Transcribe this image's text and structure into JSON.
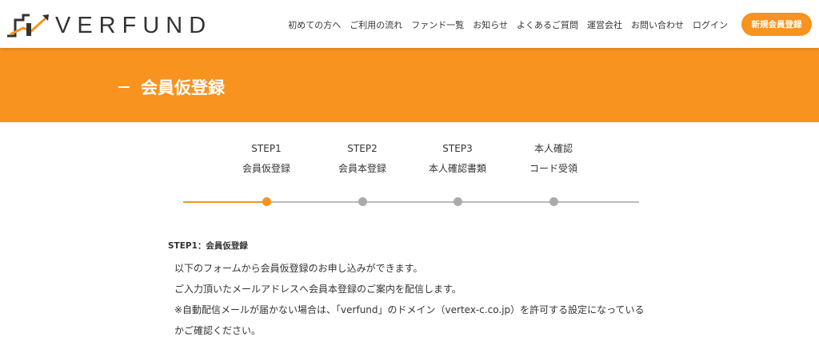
{
  "header": {
    "logo_text": "VERFUND",
    "nav": [
      {
        "label": "初めての方へ"
      },
      {
        "label": "ご利用の流れ"
      },
      {
        "label": "ファンド一覧"
      },
      {
        "label": "お知らせ"
      },
      {
        "label": "よくあるご質問"
      },
      {
        "label": "運営会社"
      },
      {
        "label": "お問い合わせ"
      },
      {
        "label": "ログイン"
      }
    ],
    "register_label": "新規会員登録"
  },
  "banner": {
    "title": "会員仮登録"
  },
  "steps": [
    {
      "line1": "STEP1",
      "line2": "会員仮登録",
      "active": true
    },
    {
      "line1": "STEP2",
      "line2": "会員本登録",
      "active": false
    },
    {
      "line1": "STEP3",
      "line2": "本人確認書類",
      "active": false
    },
    {
      "line1": "本人確認",
      "line2": "コード受領",
      "active": false
    }
  ],
  "content": {
    "heading": "STEP1：会員仮登録",
    "lines": [
      "以下のフォームから会員仮登録のお申し込みができます。",
      "ご入力頂いたメールアドレスへ会員本登録のご案内を配信します。",
      "※自動配信メールが届かない場合は、「verfund」のドメイン（vertex-c.co.jp）を許可する設定になっている",
      "かご確認ください。"
    ]
  },
  "colors": {
    "accent": "#f7931e",
    "inactive_dot": "#aaaaaa",
    "track": "#bbbbbb"
  }
}
